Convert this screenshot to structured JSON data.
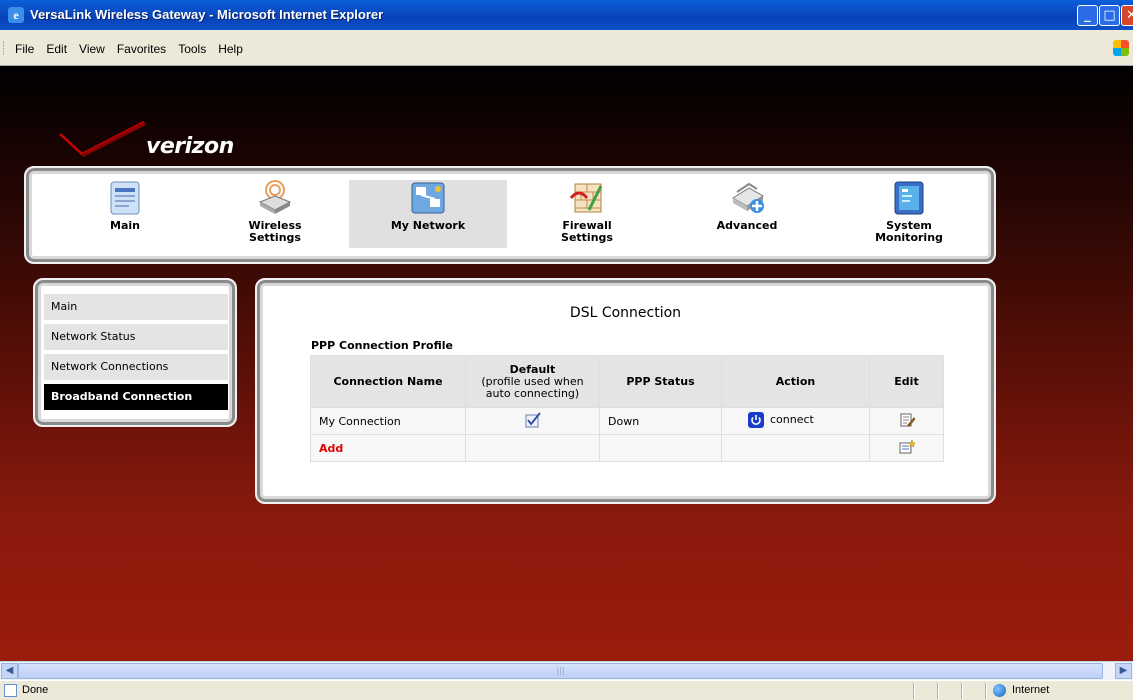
{
  "window": {
    "title": "VersaLink Wireless Gateway - Microsoft Internet Explorer",
    "controls": {
      "minimize": "_",
      "maximize": "□",
      "close": "✕"
    }
  },
  "menu": [
    "File",
    "Edit",
    "View",
    "Favorites",
    "Tools",
    "Help"
  ],
  "brand": {
    "logo_text": "verizon",
    "accent": "#cc0000"
  },
  "nav": [
    {
      "label": "Main",
      "icon": "main-page-icon"
    },
    {
      "label": "Wireless\nSettings",
      "icon": "wireless-router-icon"
    },
    {
      "label": "My Network",
      "icon": "network-map-icon",
      "active": true
    },
    {
      "label": "Firewall\nSettings",
      "icon": "firewall-icon"
    },
    {
      "label": "Advanced",
      "icon": "advanced-scanner-icon"
    },
    {
      "label": "System\nMonitoring",
      "icon": "system-monitor-icon"
    }
  ],
  "sidebar": [
    {
      "label": "Main"
    },
    {
      "label": "Network Status"
    },
    {
      "label": "Network Connections"
    },
    {
      "label": "Broadband Connection",
      "active": true
    }
  ],
  "main": {
    "title": "DSL Connection",
    "table_caption": "PPP Connection Profile",
    "columns": {
      "name": "Connection Name",
      "default": "Default",
      "default_sub": "(profile used when auto connecting)",
      "status": "PPP Status",
      "action": "Action",
      "edit": "Edit"
    },
    "rows": [
      {
        "name": "My Connection",
        "default_checked": true,
        "status": "Down",
        "action": "connect"
      }
    ],
    "add_label": "Add"
  },
  "statusbar": {
    "text": "Done",
    "zone": "Internet"
  },
  "colors": {
    "titlebar": "#0842b8",
    "active_side": "#000000",
    "add_text": "#e00000"
  }
}
